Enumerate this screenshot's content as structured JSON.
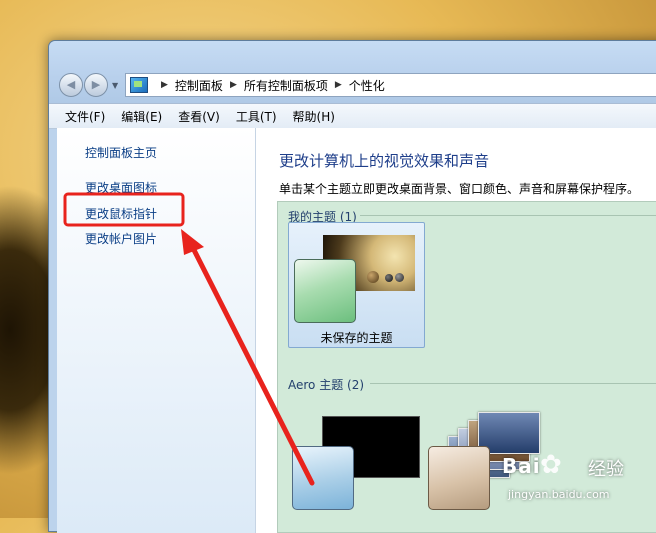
{
  "breadcrumb": [
    "控制面板",
    "所有控制面板项",
    "个性化"
  ],
  "menu": [
    "文件(F)",
    "编辑(E)",
    "查看(V)",
    "工具(T)",
    "帮助(H)"
  ],
  "sidebar": {
    "home": "控制面板主页",
    "links": [
      "更改桌面图标",
      "更改鼠标指针",
      "更改帐户图片"
    ]
  },
  "main": {
    "heading": "更改计算机上的视觉效果和声音",
    "subtext": "单击某个主题立即更改桌面背景、窗口颜色、声音和屏幕保护程序。",
    "my_themes": {
      "label": "我的主题 (1)",
      "items": [
        "未保存的主题"
      ]
    },
    "aero_themes": {
      "label": "Aero 主题 (2)"
    }
  },
  "watermark": {
    "brand": "Bai",
    "brand2": "经验",
    "url": "jingyan.baidu.com"
  },
  "colors": {
    "highlight": "#e8231d",
    "link": "#0b3f86",
    "heading": "#1e3e8a",
    "theme_panel": "#d2ead9"
  },
  "icons": [
    "back-arrow-icon",
    "forward-arrow-icon",
    "control-panel-icon",
    "baidu-paw-icon"
  ]
}
